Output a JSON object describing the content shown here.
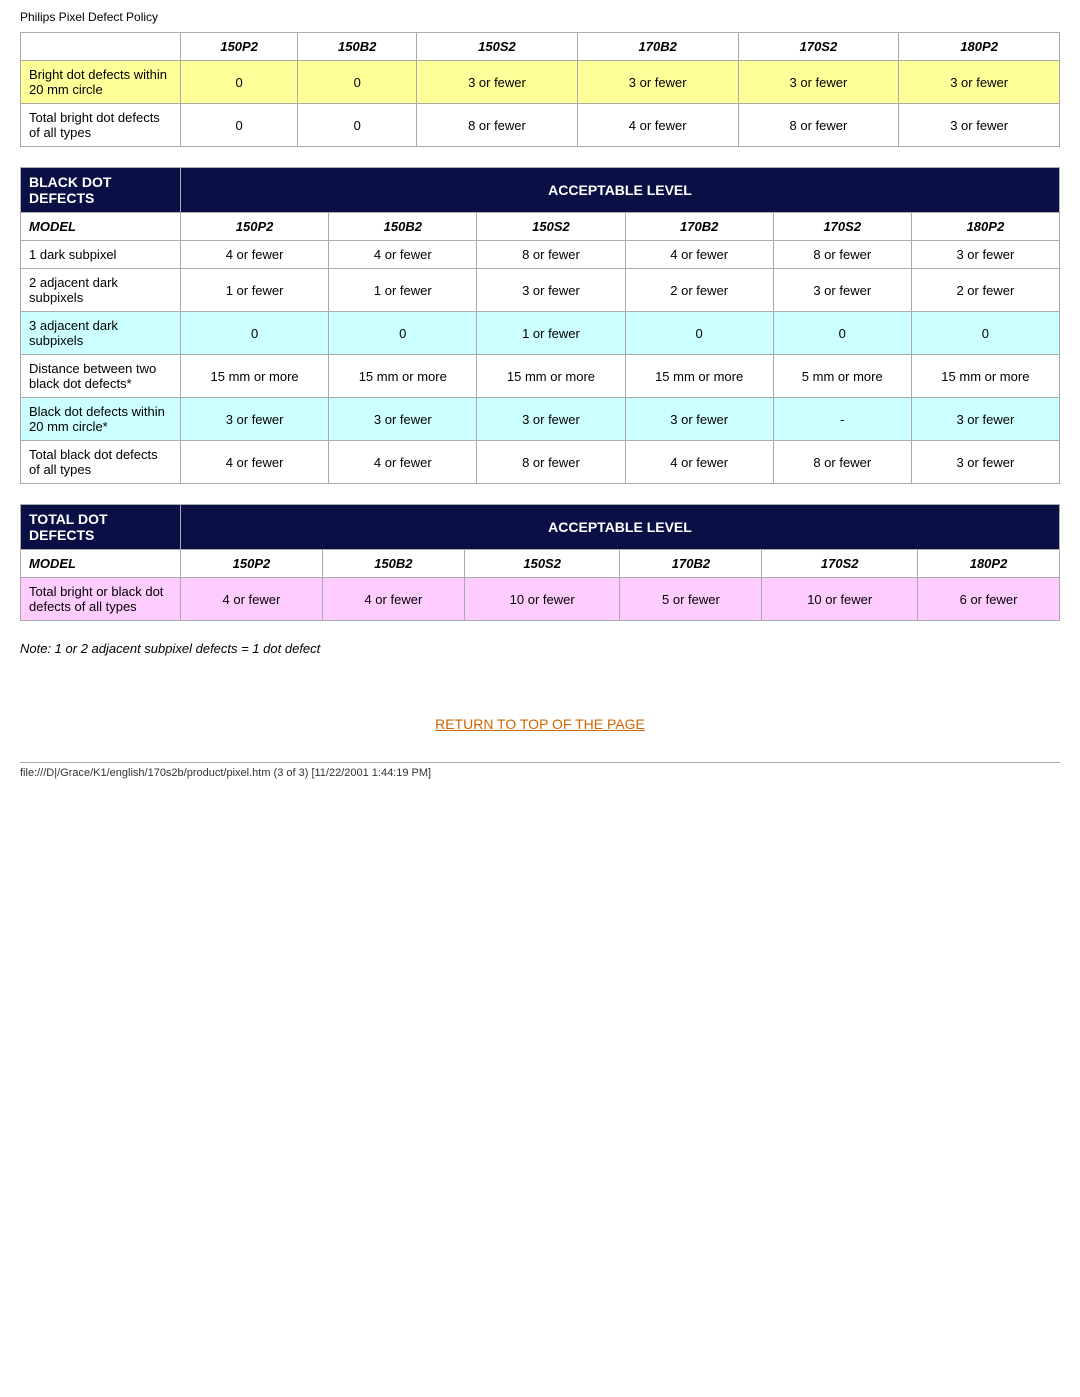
{
  "page": {
    "title": "Philips Pixel Defect Policy"
  },
  "bright_dot_table": {
    "rows": [
      {
        "label": "Bright dot defects within 20 mm circle",
        "values": [
          "0",
          "0",
          "3 or fewer",
          "3 or fewer",
          "3 or fewer",
          "3 or fewer"
        ],
        "style": "yellow"
      },
      {
        "label": "Total bright dot defects of all types",
        "values": [
          "0",
          "0",
          "8 or fewer",
          "4 or fewer",
          "8 or fewer",
          "3 or fewer"
        ],
        "style": "white"
      }
    ],
    "models": [
      "150P2",
      "150B2",
      "150S2",
      "170B2",
      "170S2",
      "180P2"
    ]
  },
  "black_dot_section": {
    "header_left": "BLACK DOT DEFECTS",
    "header_right": "ACCEPTABLE LEVEL",
    "model_label": "MODEL",
    "models": [
      "150P2",
      "150B2",
      "150S2",
      "170B2",
      "170S2",
      "180P2"
    ],
    "rows": [
      {
        "label": "1 dark subpixel",
        "values": [
          "4 or fewer",
          "4 or fewer",
          "8 or fewer",
          "4 or fewer",
          "8 or fewer",
          "3 or fewer"
        ],
        "style": "white"
      },
      {
        "label": "2 adjacent dark subpixels",
        "values": [
          "1 or fewer",
          "1 or fewer",
          "3 or fewer",
          "2 or fewer",
          "3 or fewer",
          "2 or fewer"
        ],
        "style": "white"
      },
      {
        "label": "3 adjacent dark subpixels",
        "values": [
          "0",
          "0",
          "1 or fewer",
          "0",
          "0",
          "0"
        ],
        "style": "cyan"
      },
      {
        "label": "Distance between two black dot defects*",
        "values": [
          "15 mm or more",
          "15 mm or more",
          "15 mm or more",
          "15 mm or more",
          "5 mm or more",
          "15 mm or more"
        ],
        "style": "white"
      },
      {
        "label": "Black dot defects within 20 mm circle*",
        "values": [
          "3 or fewer",
          "3 or fewer",
          "3 or fewer",
          "3 or fewer",
          "-",
          "3 or fewer"
        ],
        "style": "cyan"
      },
      {
        "label": "Total black dot defects of all types",
        "values": [
          "4 or fewer",
          "4 or fewer",
          "8 or fewer",
          "4 or fewer",
          "8 or fewer",
          "3 or fewer"
        ],
        "style": "white"
      }
    ]
  },
  "total_dot_section": {
    "header_left": "TOTAL DOT DEFECTS",
    "header_right": "ACCEPTABLE LEVEL",
    "model_label": "MODEL",
    "models": [
      "150P2",
      "150B2",
      "150S2",
      "170B2",
      "170S2",
      "180P2"
    ],
    "rows": [
      {
        "label": "Total bright or black dot defects of all types",
        "values": [
          "4 or fewer",
          "4 or fewer",
          "10 or fewer",
          "5 or fewer",
          "10 or fewer",
          "6 or fewer"
        ],
        "style": "pink"
      }
    ]
  },
  "note": "Note: 1 or 2 adjacent subpixel defects = 1 dot defect",
  "return_link": {
    "text": "RETURN TO TOP OF THE PAGE",
    "href": "#"
  },
  "footer": {
    "text": "file:///D|/Grace/K1/english/170s2b/product/pixel.htm (3 of 3) [11/22/2001 1:44:19 PM]"
  }
}
